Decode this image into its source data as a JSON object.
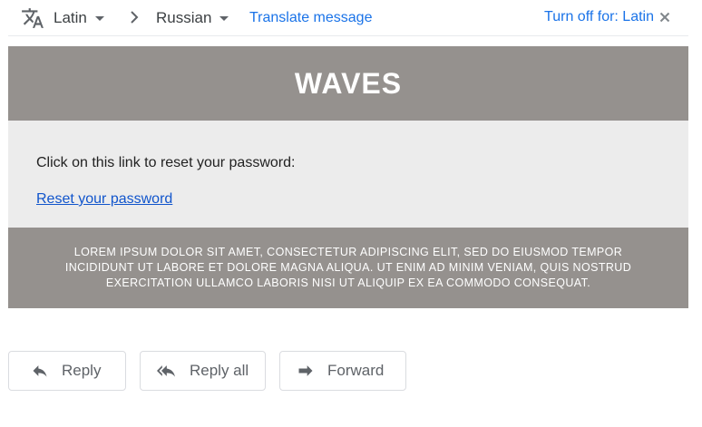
{
  "translate_bar": {
    "icon": "translate-icon",
    "source_language": "Latin",
    "target_language": "Russian",
    "translate_link": "Translate message",
    "turn_off_label": "Turn off for: Latin",
    "close_icon": "close-icon"
  },
  "email": {
    "header_title": "WAVES",
    "instruction": "Click on this link to reset your password:",
    "reset_link": "Reset your password",
    "footer_text": "LOREM IPSUM DOLOR SIT AMET, CONSECTETUR ADIPISCING ELIT, SED DO EIUSMOD TEMPOR INCIDIDUNT UT LABORE ET DOLORE MAGNA ALIQUA. UT ENIM AD MINIM VENIAM, QUIS NOSTRUD EXERCITATION ULLAMCO LABORIS NISI UT ALIQUIP EX EA COMMODO CONSEQUAT.",
    "colors": {
      "header_bg": "#95918e",
      "content_bg": "#ececec",
      "link": "#1155cc"
    }
  },
  "actions": {
    "reply_label": "Reply",
    "reply_all_label": "Reply all",
    "forward_label": "Forward"
  },
  "colors": {
    "accent": "#1a73e8",
    "text": "#3c4043",
    "icon": "#5f6368"
  }
}
